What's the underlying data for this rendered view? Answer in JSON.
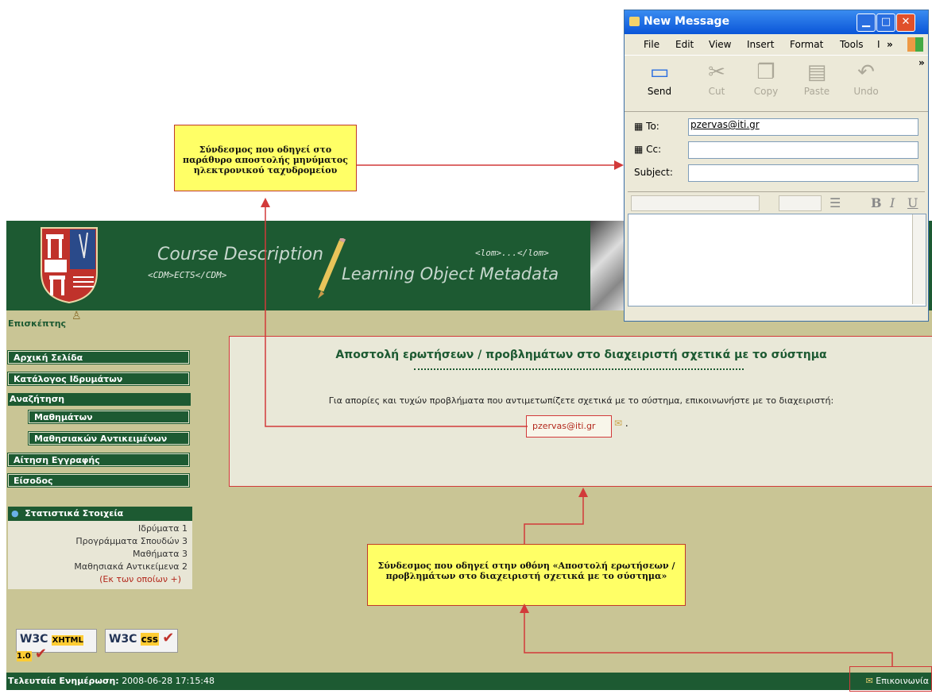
{
  "site": {
    "banner": {
      "title": "Course Description",
      "cdm": "<CDM>ECTS</CDM>",
      "lom_tag": "<lom>...</lom>",
      "lom_title": "Learning Object Metadata"
    },
    "visitor_label": "Επισκέπτης",
    "nav": {
      "home": "Αρχική Σελίδα",
      "institutions": "Κατάλογος Ιδρυμάτων",
      "search": "Αναζήτηση",
      "courses": "Μαθημάτων",
      "learning_objects": "Μαθησιακών Αντικειμένων",
      "registration": "Αίτηση Εγγραφής",
      "login": "Είσοδος"
    },
    "stats": {
      "title": "Στατιστικά Στοιχεία",
      "rows": [
        "Ιδρύματα 1",
        "Προγράμματα Σπουδών 3",
        "Μαθήματα 3",
        "Μαθησιακά Αντικείμενα 2"
      ],
      "more": "(Εκ των οποίων +)"
    },
    "badges": {
      "xhtml": "XHTML 1.0",
      "css": "css",
      "w3c": "W3C"
    },
    "footer": {
      "updated_label": "Τελευταία Ενημέρωση:",
      "updated_value": "2008-06-28 17:15:48",
      "contact": "Επικοινωνία"
    },
    "content": {
      "title": "Αποστολή ερωτήσεων / προβλημάτων στο διαχειριστή σχετικά με το σύστημα",
      "text": "Για απορίες και τυχών προβλήματα που αντιμετωπίζετε σχετικά με το σύστημα, επικοινωνήστε με το διαχειριστή:",
      "email": "pzervas@iti.gr",
      "after": "."
    }
  },
  "callouts": {
    "email_window": "Σύνδεσμος που οδηγεί στο παράθυρο αποστολής μηνύματος ηλεκτρονικού ταχυδρομείου",
    "contact_screen": "Σύνδεσμος που οδηγεί στην οθόνη «Αποστολή ερωτήσεων / προβλημάτων στο διαχειριστή σχετικά με το σύστημα»"
  },
  "mail_window": {
    "title": "New Message",
    "menu": [
      "File",
      "Edit",
      "View",
      "Insert",
      "Format",
      "Tools",
      "I"
    ],
    "menu_more": "»",
    "toolbar_more": "»",
    "tools": [
      {
        "label": "Send",
        "icon": "send-icon"
      },
      {
        "label": "Cut",
        "icon": "cut-icon"
      },
      {
        "label": "Copy",
        "icon": "copy-icon"
      },
      {
        "label": "Paste",
        "icon": "paste-icon"
      },
      {
        "label": "Undo",
        "icon": "undo-icon"
      }
    ],
    "to_label": "To:",
    "to_value": "pzervas@iti.gr",
    "cc_label": "Cc:",
    "cc_value": "",
    "subject_label": "Subject:",
    "subject_value": "",
    "format_buttons": [
      "B",
      "I",
      "U"
    ]
  }
}
